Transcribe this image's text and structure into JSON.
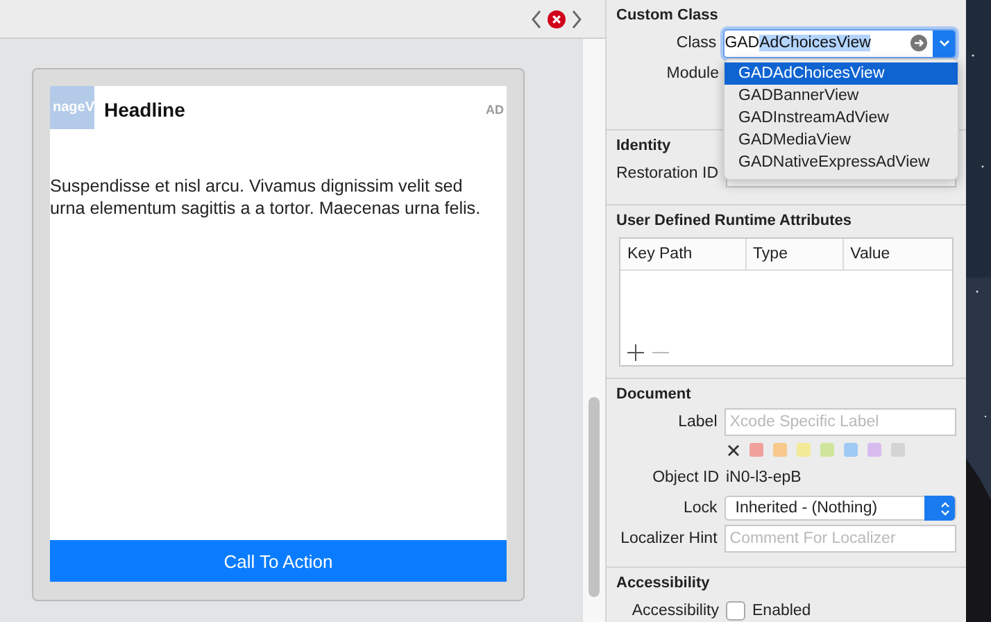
{
  "ad_view": {
    "image_label": "nageV",
    "headline": "Headline",
    "badge": "AD",
    "body": "Suspendisse et nisl arcu. Vivamus dignissim velit sed urna elementum sagittis a a tortor. Maecenas urna felis.",
    "call_to_action": "Call To Action"
  },
  "inspector": {
    "custom_class": {
      "title": "Custom Class",
      "class_label": "Class",
      "class_typed": "GAD",
      "class_completion": "AdChoicesView",
      "module_label": "Module",
      "suggestions": [
        {
          "label": "GADAdChoicesView",
          "selected": true
        },
        {
          "label": "GADBannerView",
          "selected": false
        },
        {
          "label": "GADInstreamAdView",
          "selected": false
        },
        {
          "label": "GADMediaView",
          "selected": false
        },
        {
          "label": "GADNativeExpressAdView",
          "selected": false
        }
      ]
    },
    "identity": {
      "title": "Identity",
      "restoration_id_label": "Restoration ID"
    },
    "runtime_attributes": {
      "title": "User Defined Runtime Attributes",
      "columns": [
        "Key Path",
        "Type",
        "Value"
      ]
    },
    "document": {
      "title": "Document",
      "label_label": "Label",
      "label_placeholder": "Xcode Specific Label",
      "colors": [
        {
          "color": "#f2a09c"
        },
        {
          "color": "#f7c98c"
        },
        {
          "color": "#f3ea98"
        },
        {
          "color": "#cfe59c"
        },
        {
          "color": "#9fcaf3"
        },
        {
          "color": "#d8bbee"
        },
        {
          "color": "#d4d4d4"
        }
      ],
      "object_id_label": "Object ID",
      "object_id": "iN0-l3-epB",
      "lock_label": "Lock",
      "lock_value": "Inherited - (Nothing)",
      "hint_label": "Localizer Hint",
      "hint_placeholder": "Comment For Localizer"
    },
    "accessibility": {
      "title": "Accessibility",
      "label": "Accessibility",
      "checkbox": {
        "label": "Enabled",
        "checked": false
      }
    }
  }
}
